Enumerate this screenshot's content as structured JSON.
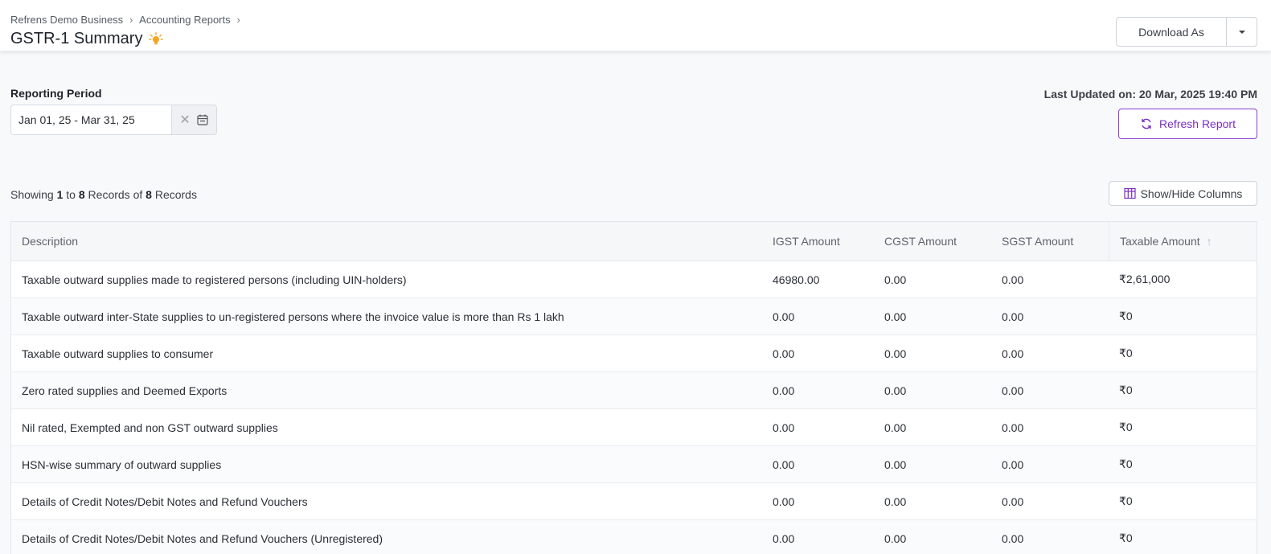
{
  "breadcrumb": {
    "items": [
      "Refrens Demo Business",
      "Accounting Reports"
    ]
  },
  "page": {
    "title": "GSTR-1 Summary"
  },
  "toolbar": {
    "download_label": "Download As"
  },
  "reporting": {
    "label": "Reporting Period",
    "date_range": "Jan 01, 25 - Mar 31, 25",
    "last_updated": "Last Updated on: 20 Mar, 2025 19:40 PM",
    "refresh_label": "Refresh Report"
  },
  "records": {
    "prefix": "Showing",
    "from": "1",
    "to_word": "to",
    "to": "8",
    "records_of": "Records of",
    "total": "8",
    "suffix": "Records",
    "columns_button": "Show/Hide Columns"
  },
  "table": {
    "headers": [
      "Description",
      "IGST Amount",
      "CGST Amount",
      "SGST Amount",
      "Taxable Amount"
    ],
    "rows": [
      [
        "Taxable outward supplies made to registered persons (including UIN-holders)",
        "46980.00",
        "0.00",
        "0.00",
        "₹2,61,000"
      ],
      [
        "Taxable outward inter-State supplies to un-registered persons where the invoice value is more than Rs 1 lakh",
        "0.00",
        "0.00",
        "0.00",
        "₹0"
      ],
      [
        "Taxable outward supplies to consumer",
        "0.00",
        "0.00",
        "0.00",
        "₹0"
      ],
      [
        "Zero rated supplies and Deemed Exports",
        "0.00",
        "0.00",
        "0.00",
        "₹0"
      ],
      [
        "Nil rated, Exempted and non GST outward supplies",
        "0.00",
        "0.00",
        "0.00",
        "₹0"
      ],
      [
        "HSN-wise summary of outward supplies",
        "0.00",
        "0.00",
        "0.00",
        "₹0"
      ],
      [
        "Details of Credit Notes/Debit Notes and Refund Vouchers",
        "0.00",
        "0.00",
        "0.00",
        "₹0"
      ],
      [
        "Details of Credit Notes/Debit Notes and Refund Vouchers (Unregistered)",
        "0.00",
        "0.00",
        "0.00",
        "₹0"
      ]
    ]
  },
  "colors": {
    "accent": "#7a2fc4",
    "bulb": "#f5a623"
  }
}
